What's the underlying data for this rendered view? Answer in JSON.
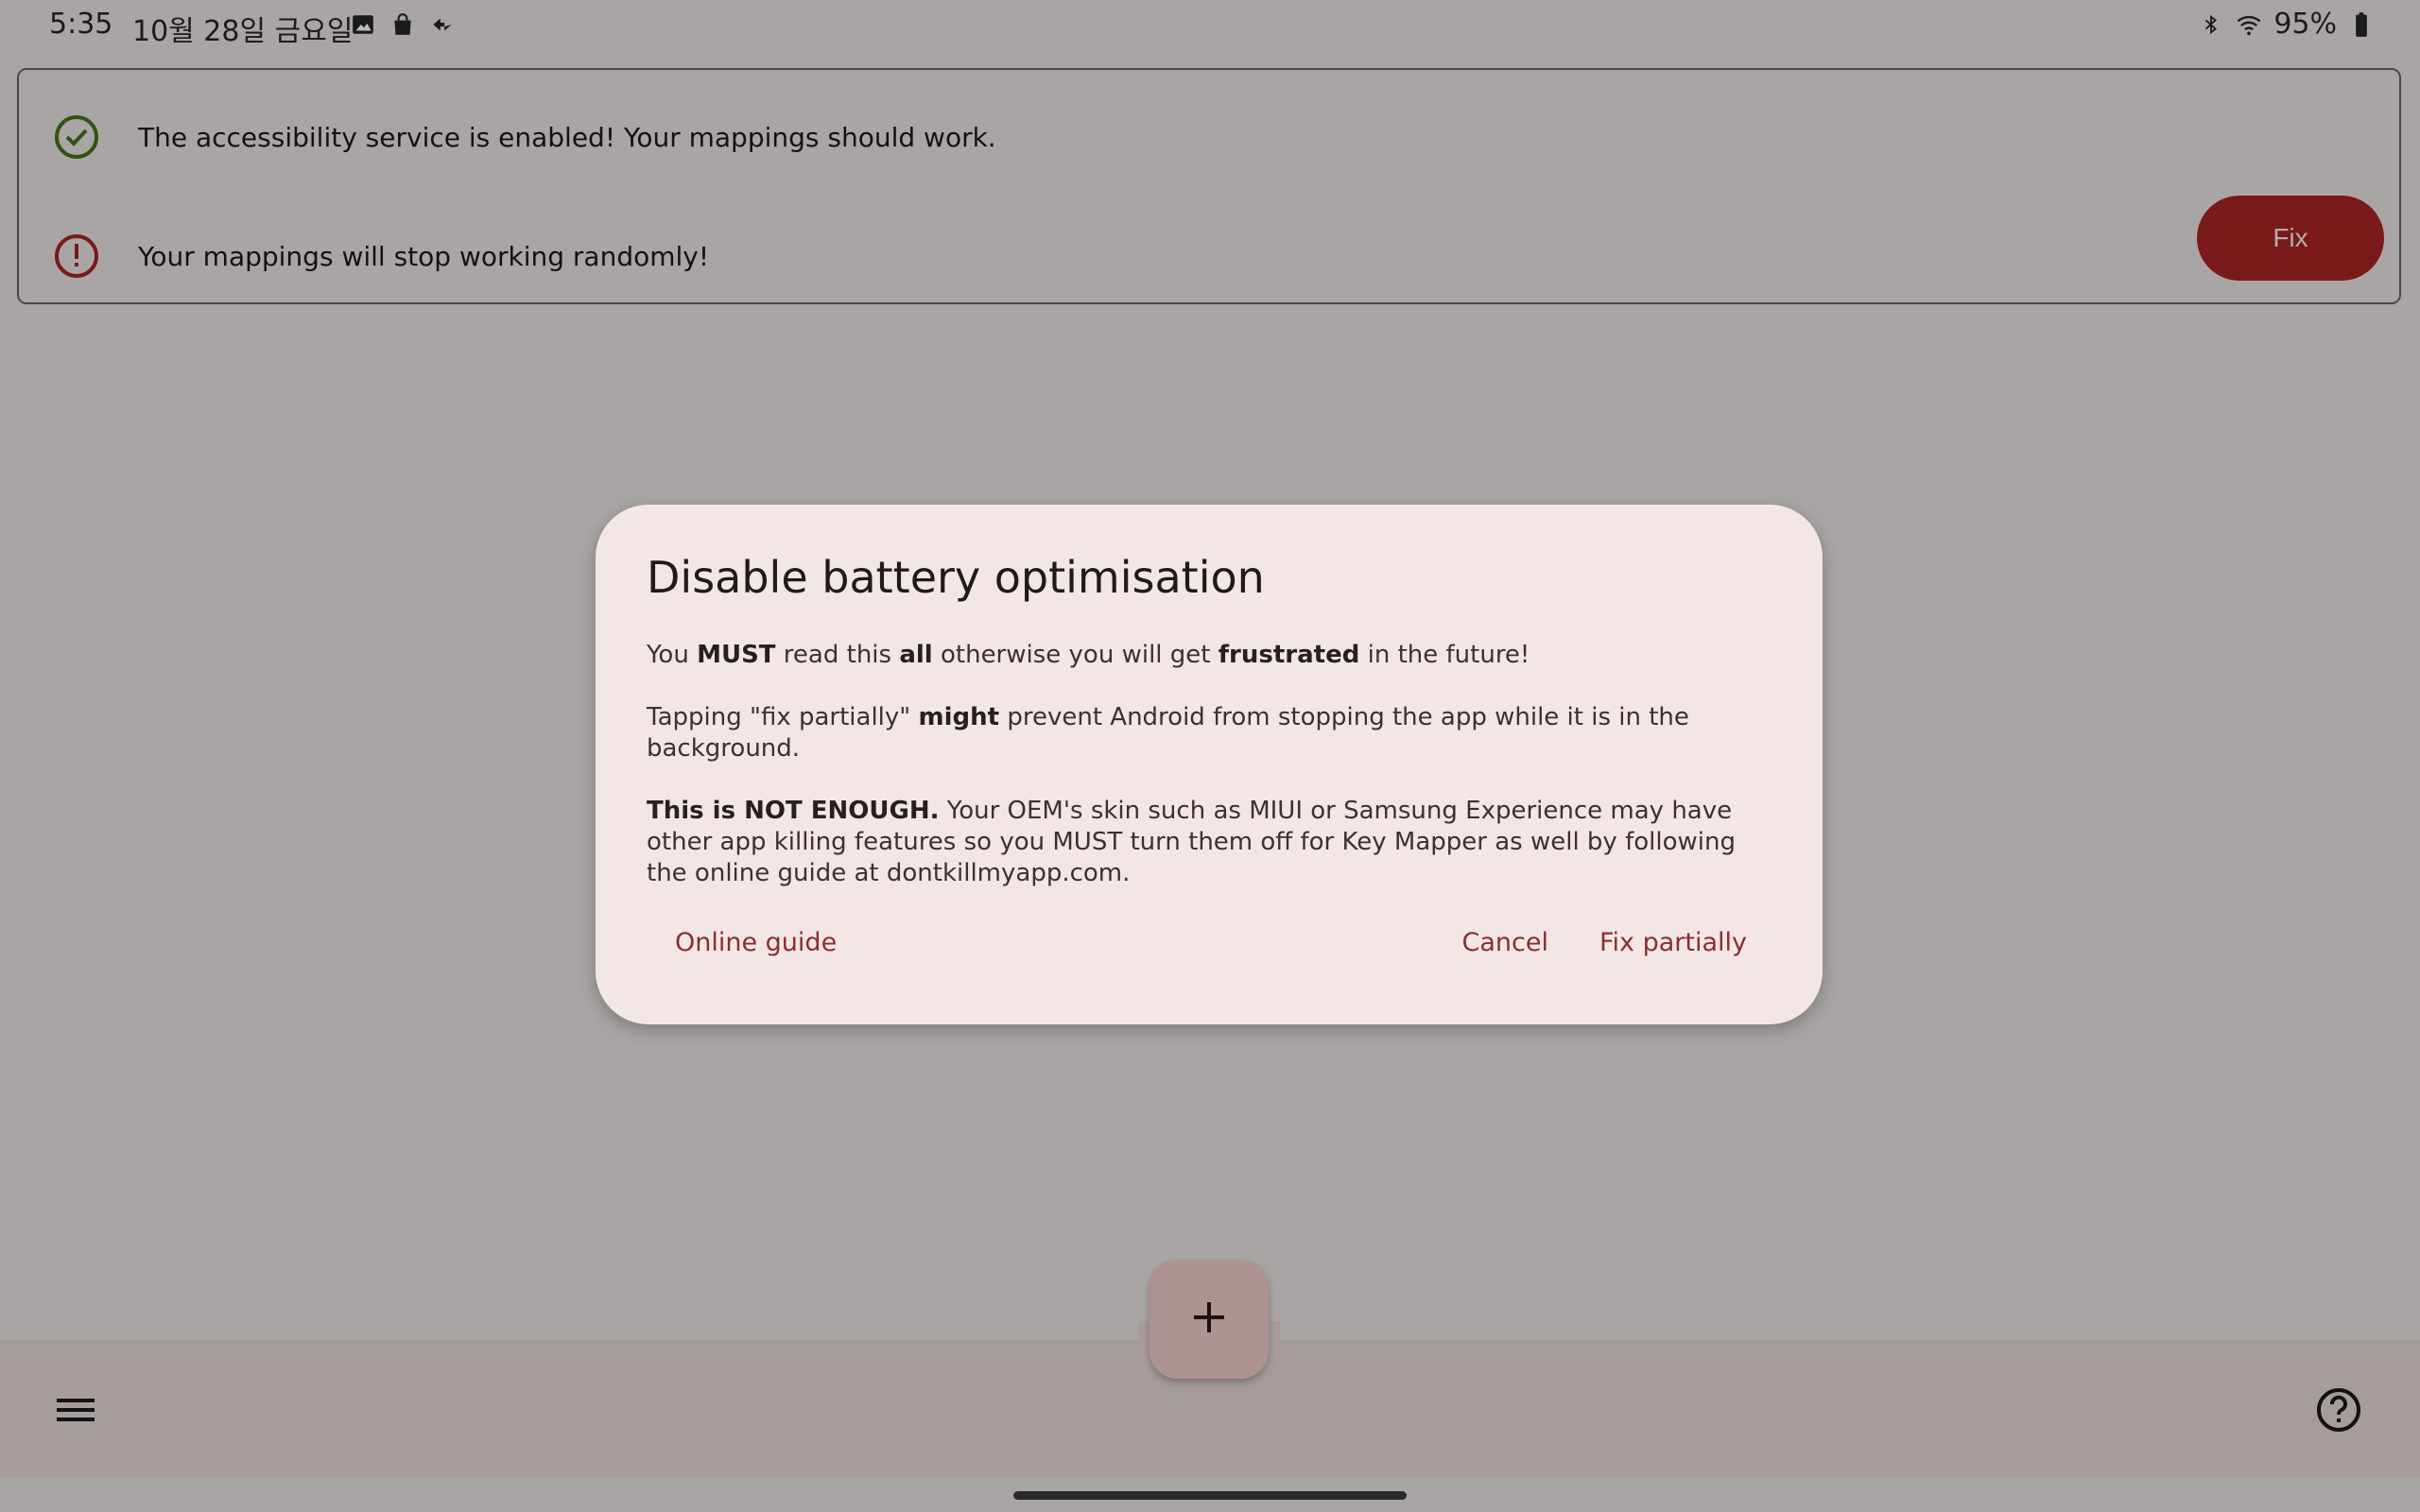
{
  "status_bar": {
    "time": "5:35",
    "date": "10월 28일 금요일",
    "battery": "95%",
    "left_icons": [
      "gallery-icon",
      "shopping-bag-icon",
      "sync-icon"
    ],
    "right_icons": [
      "bluetooth-icon",
      "wifi-icon",
      "battery-icon"
    ]
  },
  "info_card": {
    "accessibility_status": "The accessibility service is enabled! Your mappings should work.",
    "battery_warning": "Your mappings will stop working randomly!",
    "fix_label": "Fix"
  },
  "dialog": {
    "title": "Disable battery optimisation",
    "p1": {
      "t1": "You ",
      "b1": "MUST",
      "t2": " read this ",
      "b2": "all",
      "t3": " otherwise you will get ",
      "b3": "frustrated",
      "t4": " in the future!"
    },
    "p2": {
      "t1": "Tapping \"fix partially\" ",
      "b1": "might",
      "t2": " prevent Android from stopping the app while it is in the background."
    },
    "p3": {
      "b1": "This is NOT ENOUGH.",
      "t1": " Your OEM's skin such as MIUI or Samsung Experience may have other app killing features so you MUST turn them off for Key Mapper as well by following the online guide at dontkillmyapp.com."
    },
    "actions": {
      "online_guide": "Online guide",
      "cancel": "Cancel",
      "fix_partially": "Fix partially"
    }
  },
  "bottom_bar": {
    "menu_icon": "menu-icon",
    "help_icon": "help-icon",
    "fab_icon": "add-icon"
  },
  "colors": {
    "accent": "#b42525",
    "success": "#4a7a1c",
    "error": "#b42525",
    "dialog_bg": "#f3e7e6"
  }
}
